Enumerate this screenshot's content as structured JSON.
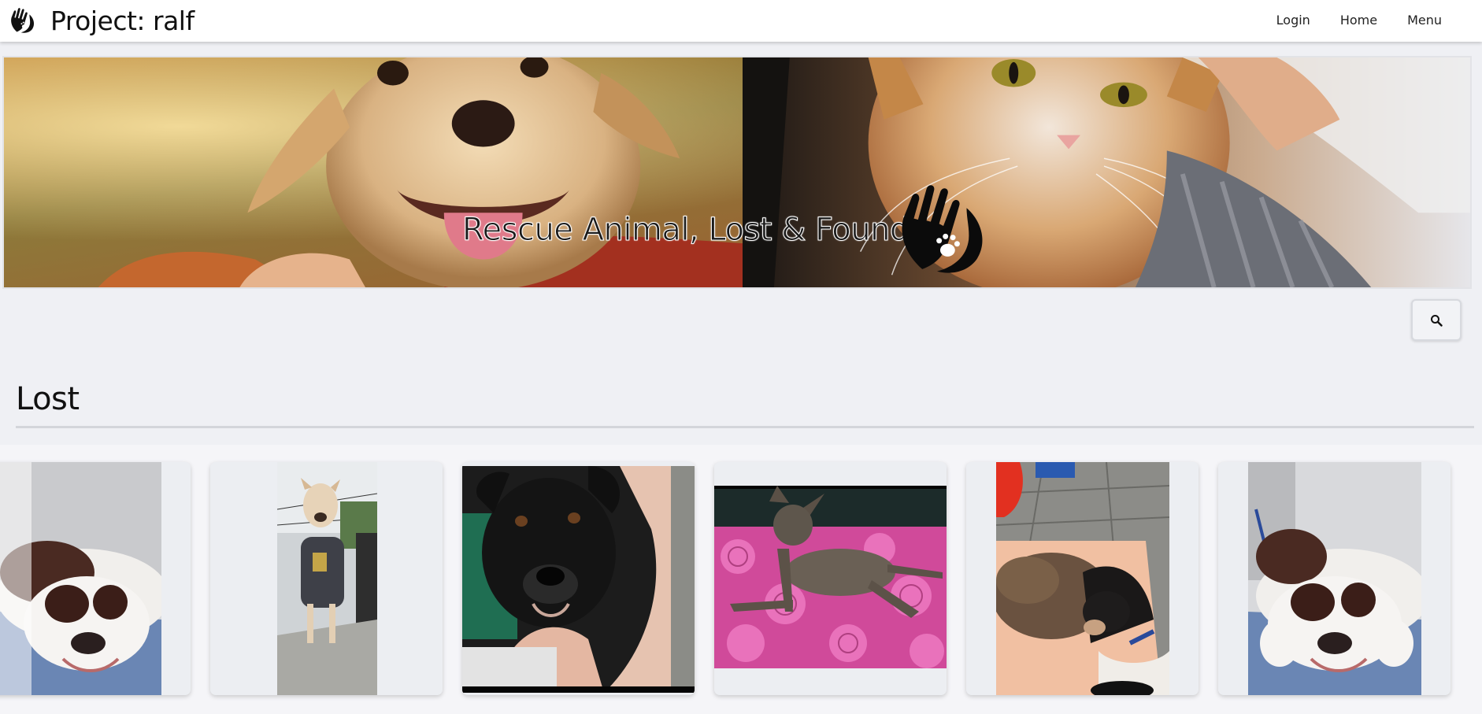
{
  "header": {
    "logo_icon": "hand-paw-logo-icon",
    "title": "Project: ralf",
    "nav": [
      {
        "label": "Login"
      },
      {
        "label": "Home"
      },
      {
        "label": "Menu"
      }
    ]
  },
  "hero": {
    "title": "Rescue Animal, Lost & Found",
    "logo_icon": "hand-paw-logo-icon"
  },
  "search": {
    "icon": "search-icon"
  },
  "lost": {
    "title": "Lost",
    "cards": [
      {
        "photo": "bulldog-lying-photo"
      },
      {
        "photo": "dog-in-shirt-photo"
      },
      {
        "photo": "black-dog-photo"
      },
      {
        "photo": "brindle-dog-on-pink-blanket-photo"
      },
      {
        "photo": "two-dogs-photo"
      },
      {
        "photo": "bulldog-lying-photo"
      }
    ]
  },
  "colors": {
    "background": "#eff0f4",
    "header_bg": "#ffffff",
    "text": "#111111"
  }
}
